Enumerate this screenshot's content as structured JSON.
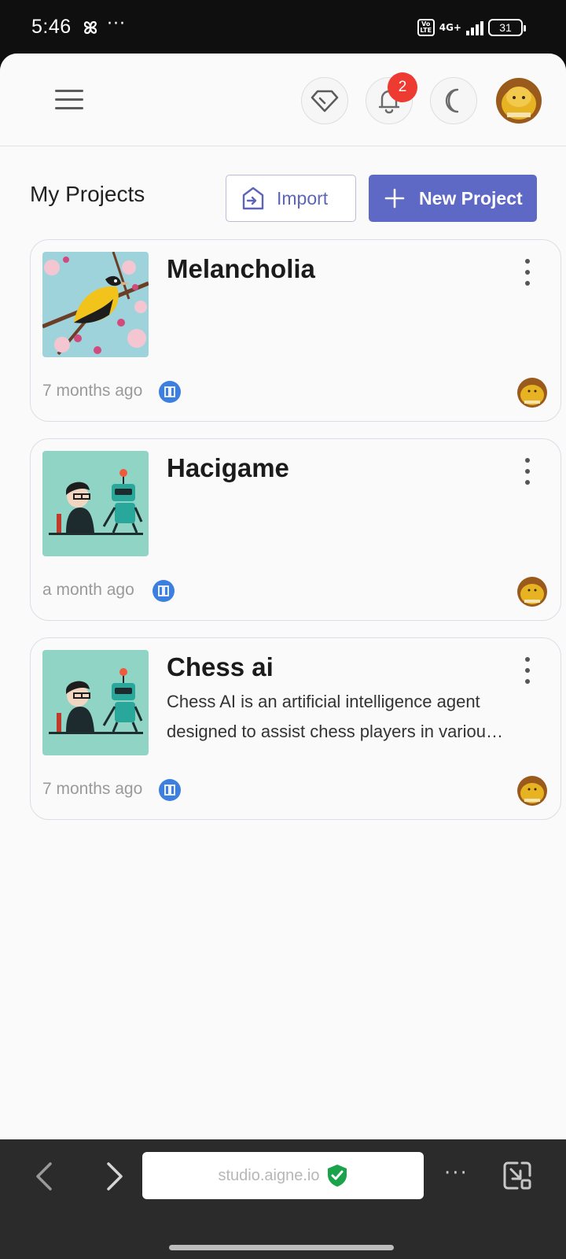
{
  "status_bar": {
    "time": "5:46",
    "overflow": "···",
    "volte_top": "Vo",
    "volte_bottom": "LTE",
    "network": "4G+",
    "battery": "31"
  },
  "header": {
    "notification_count": "2",
    "icons": [
      "menu-icon",
      "diamond-icon",
      "bell-icon",
      "moon-icon"
    ]
  },
  "page": {
    "title": "My Projects",
    "import_label": "Import",
    "new_project_label": "New Project"
  },
  "projects": [
    {
      "title": "Melancholia",
      "description_lines": [],
      "updated": "7 months ago"
    },
    {
      "title": "Hacigame",
      "description_lines": [],
      "updated": "a month ago"
    },
    {
      "title": "Chess ai",
      "description_lines": [
        "Chess AI is an artificial intelligence agent",
        "designed to assist chess players in variou…"
      ],
      "updated": "7 months ago"
    }
  ],
  "browser": {
    "url": "studio.aigne.io",
    "more": "···"
  },
  "colors": {
    "accent": "#5e69c6",
    "badge": "#ee3b32",
    "secure": "#1aa34a",
    "chain": "#3d7fe0"
  }
}
